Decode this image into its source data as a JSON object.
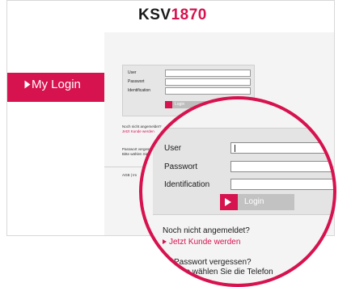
{
  "header": {
    "logo_prefix": "KSV",
    "logo_suffix": "1870"
  },
  "sidebar": {
    "login_label": "My Login"
  },
  "login": {
    "user_label": "User",
    "password_label": "Passwort",
    "identification_label": "Identification",
    "login_button": "Login",
    "not_registered": "Noch nicht angemeldet?",
    "become_customer": "Jetzt Kunde werden",
    "forgot_password": "Passwort vergessen?",
    "contact_phone": "Bitte wählen Sie die Telefon"
  },
  "small_page": {
    "not_registered": "Noch nicht angemeldet?",
    "become_customer": "Jetzt Kunde werden",
    "forgot_password": "Passwort vergessen?",
    "contact_phone": "Bitte wählen Sie die Telefon",
    "footer": "AGB | Im"
  },
  "colors": {
    "accent": "#d6124f",
    "panel": "#e4e4e4"
  }
}
